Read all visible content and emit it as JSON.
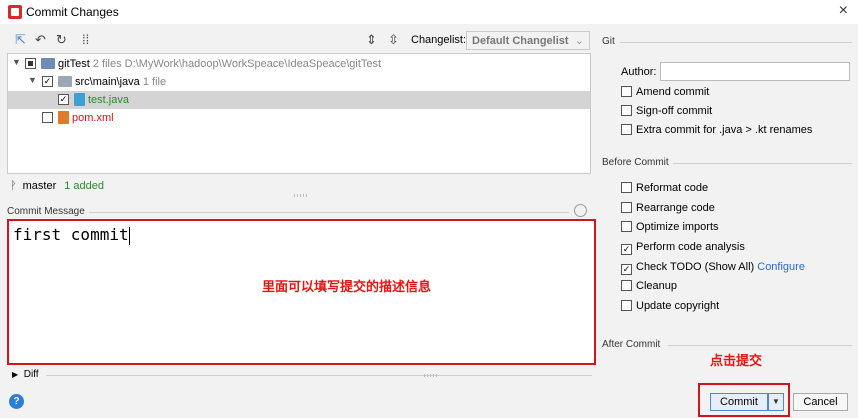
{
  "window": {
    "title": "Commit Changes",
    "close_glyph": "×"
  },
  "toolbar": {
    "icons": [
      "move-icon",
      "undo-icon",
      "refresh-icon",
      "group-icon",
      "expand-icon",
      "collapse-icon"
    ],
    "changelist_label": "Changelist:",
    "changelist_value": "Default Changelist"
  },
  "tree": {
    "root": {
      "name": "gitTest",
      "meta": "2 files  D:\\MyWork\\hadoop\\WorkSpeace\\IdeaSpeace\\gitTest"
    },
    "folder": {
      "name": "src\\main\\java",
      "meta": "1 file"
    },
    "files": [
      {
        "name": "test.java",
        "color": "#2b8a2b"
      },
      {
        "name": "pom.xml",
        "color": "#d0151b"
      }
    ]
  },
  "status": {
    "branch": "master",
    "added": "1 added"
  },
  "commit_message": {
    "label": "Commit Message",
    "text": "first commit",
    "annotation": "里面可以填写提交的描述信息"
  },
  "git": {
    "header": "Git",
    "author_label": "Author:",
    "author_value": "",
    "options": [
      {
        "label": "Amend commit",
        "checked": false
      },
      {
        "label": "Sign-off commit",
        "checked": false
      },
      {
        "label": "Extra commit for .java > .kt renames",
        "checked": false
      }
    ]
  },
  "before_commit": {
    "header": "Before Commit",
    "options": [
      {
        "label": "Reformat code",
        "checked": false
      },
      {
        "label": "Rearrange code",
        "checked": false
      },
      {
        "label": "Optimize imports",
        "checked": false
      },
      {
        "label": "Perform code analysis",
        "checked": true
      },
      {
        "label": "Check TODO (Show All)",
        "checked": true,
        "link": "Configure"
      },
      {
        "label": "Cleanup",
        "checked": false
      },
      {
        "label": "Update copyright",
        "checked": false
      }
    ]
  },
  "after_commit": {
    "header": "After Commit"
  },
  "diff": {
    "label": "Diff"
  },
  "buttons": {
    "commit": "Commit",
    "commit_annotation": "点击提交",
    "cancel": "Cancel",
    "help": "?"
  },
  "colors": {
    "accent": "#2a6bc7",
    "annotation": "#e81414",
    "added": "#2b8a2b"
  }
}
